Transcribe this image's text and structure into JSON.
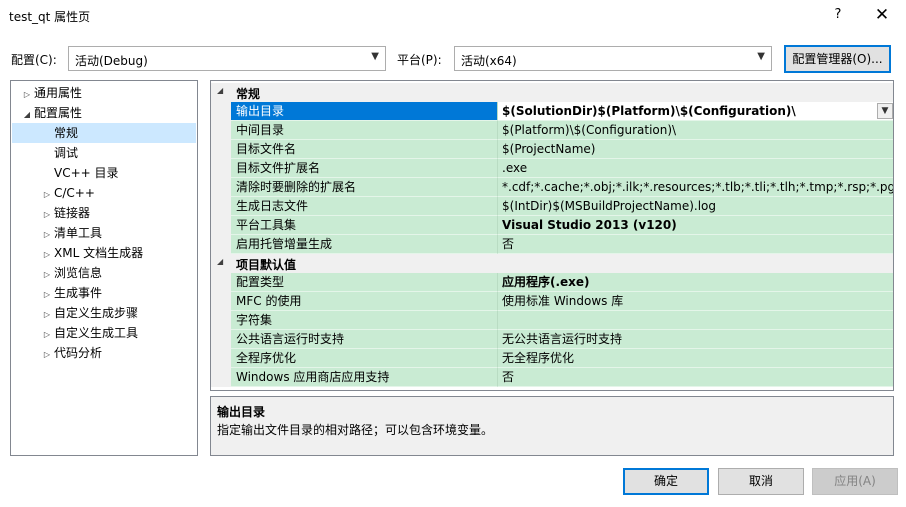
{
  "window": {
    "title": "test_qt 属性页",
    "help": "?",
    "close": "✕"
  },
  "toolbar": {
    "config_label": "配置(C):",
    "config_value": "活动(Debug)",
    "platform_label": "平台(P):",
    "platform_value": "活动(x64)",
    "config_manager": "配置管理器(O)..."
  },
  "tree": [
    {
      "label": "通用属性",
      "expanded": false,
      "level": 0
    },
    {
      "label": "配置属性",
      "expanded": true,
      "level": 0
    },
    {
      "label": "常规",
      "level": 1,
      "selected": true
    },
    {
      "label": "调试",
      "level": 1
    },
    {
      "label": "VC++ 目录",
      "level": 1
    },
    {
      "label": "C/C++",
      "level": 1,
      "expandable": true
    },
    {
      "label": "链接器",
      "level": 1,
      "expandable": true
    },
    {
      "label": "清单工具",
      "level": 1,
      "expandable": true
    },
    {
      "label": "XML 文档生成器",
      "level": 1,
      "expandable": true
    },
    {
      "label": "浏览信息",
      "level": 1,
      "expandable": true
    },
    {
      "label": "生成事件",
      "level": 1,
      "expandable": true
    },
    {
      "label": "自定义生成步骤",
      "level": 1,
      "expandable": true
    },
    {
      "label": "自定义生成工具",
      "level": 1,
      "expandable": true
    },
    {
      "label": "代码分析",
      "level": 1,
      "expandable": true
    }
  ],
  "grid": {
    "cat_general": "常规",
    "cat_defaults": "项目默认值",
    "general": [
      {
        "name": "输出目录",
        "value": "$(SolutionDir)$(Platform)\\$(Configuration)\\"
      },
      {
        "name": "中间目录",
        "value": "$(Platform)\\$(Configuration)\\"
      },
      {
        "name": "目标文件名",
        "value": "$(ProjectName)"
      },
      {
        "name": "目标文件扩展名",
        "value": ".exe"
      },
      {
        "name": "清除时要删除的扩展名",
        "value": "*.cdf;*.cache;*.obj;*.ilk;*.resources;*.tlb;*.tli;*.tlh;*.tmp;*.rsp;*.pgc;*.pgd"
      },
      {
        "name": "生成日志文件",
        "value": "$(IntDir)$(MSBuildProjectName).log"
      },
      {
        "name": "平台工具集",
        "value": "Visual Studio 2013 (v120)"
      },
      {
        "name": "启用托管增量生成",
        "value": "否"
      }
    ],
    "defaults": [
      {
        "name": "配置类型",
        "value": "应用程序(.exe)"
      },
      {
        "name": "MFC 的使用",
        "value": "使用标准 Windows 库"
      },
      {
        "name": "字符集",
        "value": ""
      },
      {
        "name": "公共语言运行时支持",
        "value": "无公共语言运行时支持"
      },
      {
        "name": "全程序优化",
        "value": "无全程序优化"
      },
      {
        "name": "Windows 应用商店应用支持",
        "value": "否"
      }
    ]
  },
  "description": {
    "title": "输出目录",
    "text": "指定输出文件目录的相对路径；可以包含环境变量。"
  },
  "buttons": {
    "ok": "确定",
    "cancel": "取消",
    "apply": "应用(A)"
  }
}
